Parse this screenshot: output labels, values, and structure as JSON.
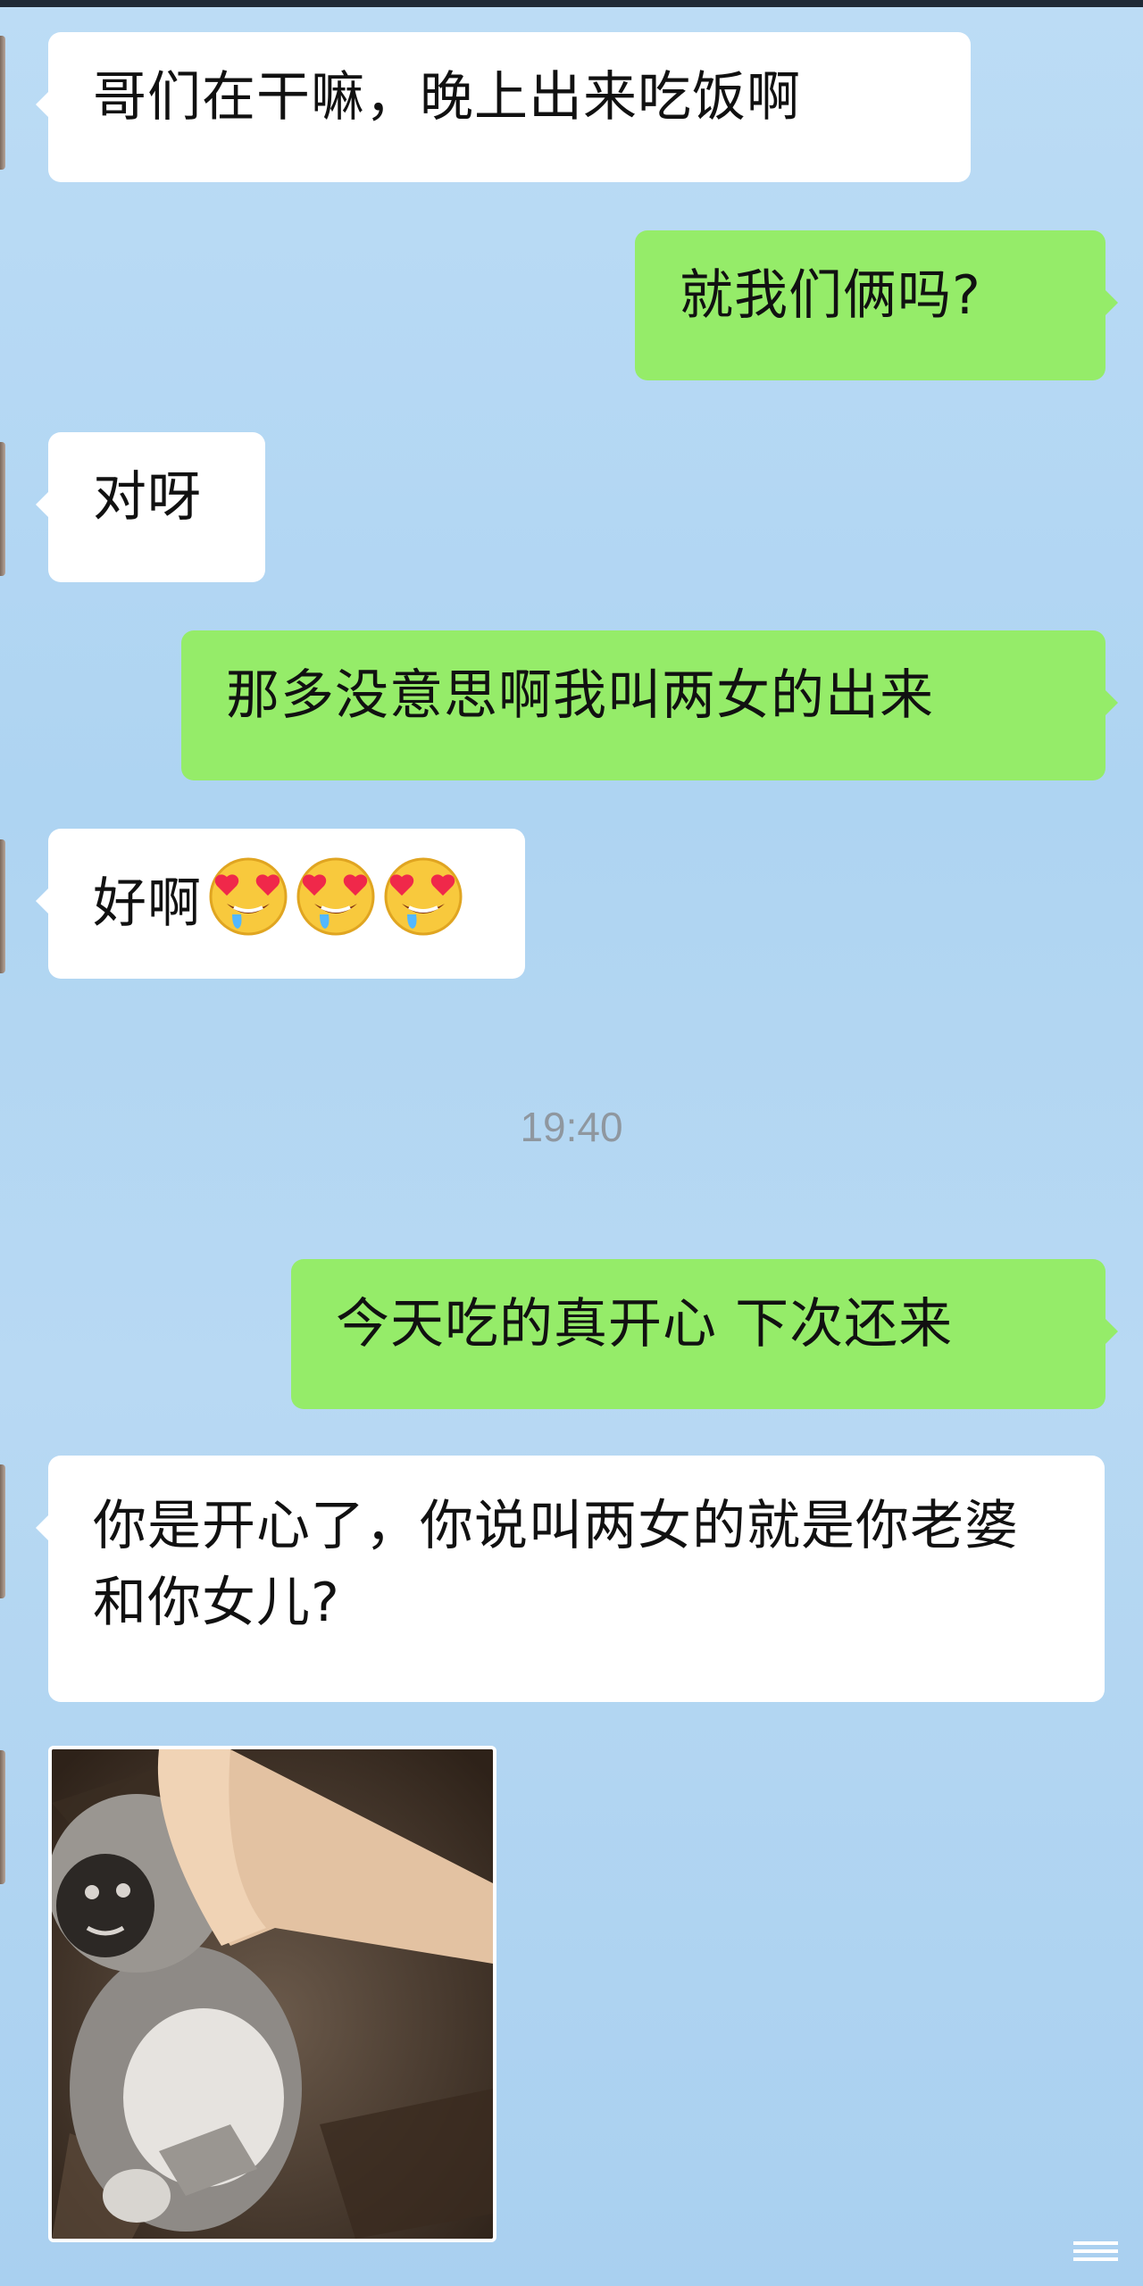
{
  "messages": [
    {
      "text": "哥们在干嘛，晚上出来吃饭啊"
    },
    {
      "text": "就我们俩吗?"
    },
    {
      "text": "对呀"
    },
    {
      "text": "那多没意思啊我叫两女的出来"
    },
    {
      "text": "好啊",
      "emoji": [
        "heart-eyes-drool",
        "heart-eyes-drool",
        "heart-eyes-drool"
      ]
    },
    {
      "text": "今天吃的真开心 下次还来"
    },
    {
      "text": "你是开心了，你说叫两女的就是你老婆和你女儿?"
    }
  ],
  "timestamp": "19:40",
  "colors": {
    "incoming_bubble": "#ffffff",
    "outgoing_bubble": "#95ec69",
    "background": "#b4d8f3",
    "timestamp_text": "#8f979f"
  },
  "sticker": {
    "icon": "kicking-monkey-sticker"
  },
  "bottom_icon": "menu-lines-icon"
}
